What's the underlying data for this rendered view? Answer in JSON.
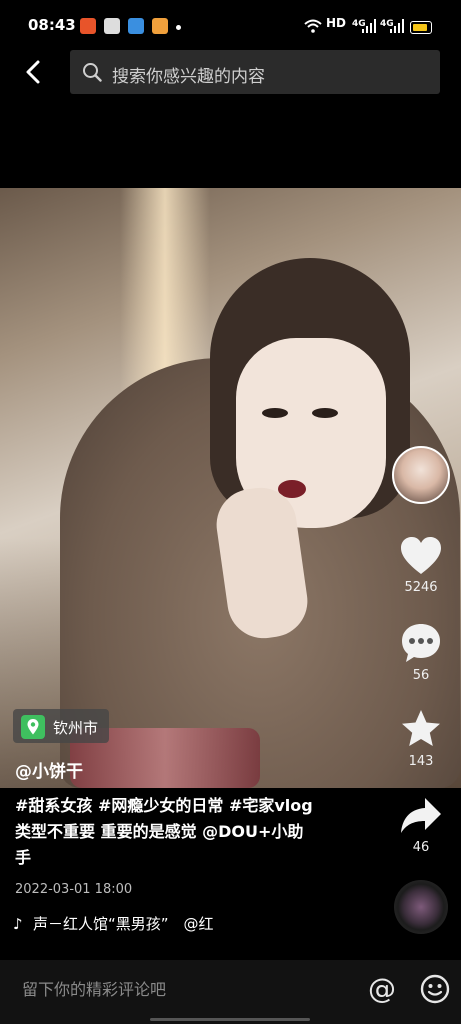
{
  "status_bar": {
    "time": "08:43",
    "network_label": "HD",
    "signal_1": "4G",
    "signal_2": "4G"
  },
  "header": {
    "search_placeholder": "搜索你感兴趣的内容"
  },
  "actions": {
    "likes": "5246",
    "comments": "56",
    "favorites": "143",
    "shares": "46"
  },
  "video_info": {
    "location": "钦州市",
    "author": "@小饼干",
    "description": "#甜系女孩 #网瘾少女的日常 #宅家vlog 类型不重要 重要的是感觉 @DOU+小助手",
    "date": "2022-03-01 18:00",
    "music": "声－红人馆“黑男孩”　@红"
  },
  "comment_bar": {
    "placeholder": "留下你的精彩评论吧"
  },
  "colors": {
    "background": "#000000",
    "location_pin": "#3fbf5f",
    "battery": "#f5c518"
  }
}
